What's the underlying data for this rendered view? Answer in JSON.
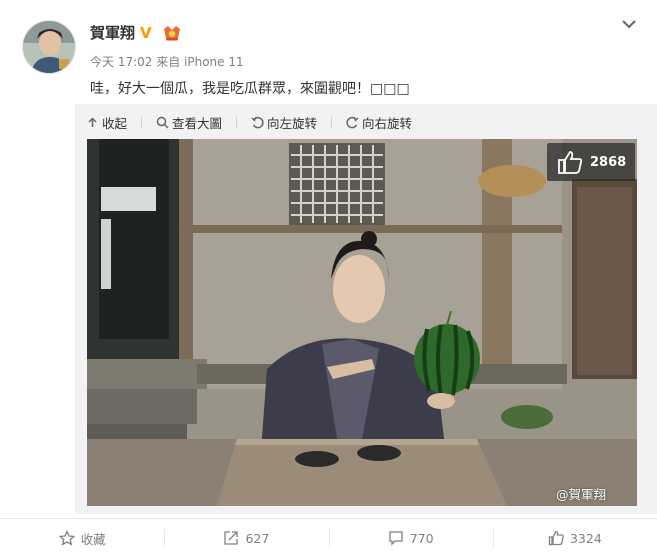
{
  "post": {
    "username": "賀軍翔",
    "verified_mark": "V",
    "meta": "今天 17:02 来自 iPhone 11",
    "content": "哇，好大一個瓜，我是吃瓜群眾，來圍觀吧！□□□"
  },
  "toolbar": {
    "collapse": "收起",
    "view_large": "查看大圖",
    "rotate_left": "向左旋转",
    "rotate_right": "向右旋转"
  },
  "media": {
    "like_count": "2868",
    "watermark": "@賀軍翔"
  },
  "footer": {
    "favorite": "收藏",
    "repost": "627",
    "comment": "770",
    "like": "3324"
  },
  "colors": {
    "verify": "#f5a000",
    "muted": "#808080",
    "panel": "#f2f2f5"
  }
}
